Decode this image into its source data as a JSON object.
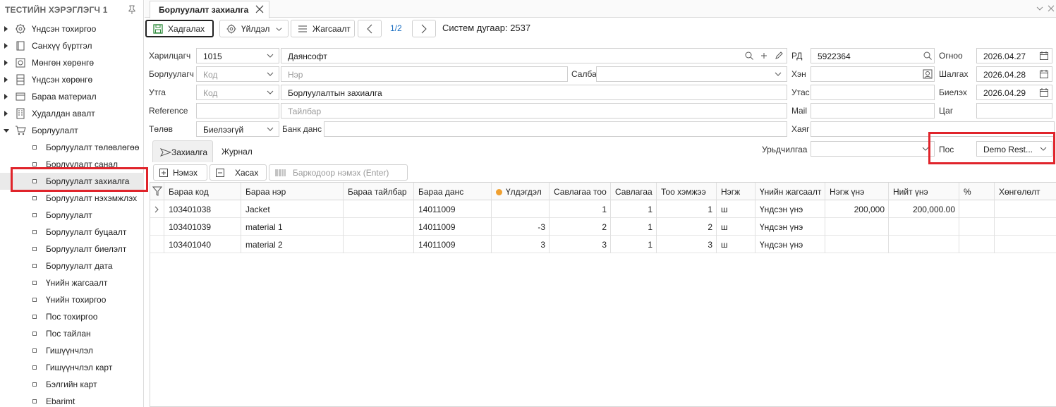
{
  "sidebar": {
    "title": "ТЕСТИЙН ХЭРЭГЛЭГЧ 1",
    "nodes": [
      {
        "label": "Үндсэн тохиргоо",
        "icon": "gear-icon"
      },
      {
        "label": "Санхүү бүртгэл",
        "icon": "book-icon"
      },
      {
        "label": "Мөнгөн хөрөнгө",
        "icon": "safe-icon"
      },
      {
        "label": "Үндсэн хөрөнгө",
        "icon": "cabinet-icon"
      },
      {
        "label": "Бараа материал",
        "icon": "box-icon"
      },
      {
        "label": "Худалдан авалт",
        "icon": "building-icon"
      },
      {
        "label": "Борлуулалт",
        "icon": "cart-icon"
      }
    ],
    "leaves": [
      "Борлуулалт төлөвлөгөө",
      "Борлуулалт санал",
      "Борлуулалт захиалга",
      "Борлуулалт нэхэмжлэх",
      "Борлуулалт",
      "Борлуулалт буцаалт",
      "Борлуулалт биелэлт",
      "Борлуулалт дата",
      "Үнийн жагсаалт",
      "Үнийн тохиргоо",
      "Пос тохиргоо",
      "Пос тайлан",
      "Гишүүнчлэл",
      "Гишүүнчлэл карт",
      "Бэлгийн карт",
      "Ebarimt"
    ]
  },
  "tab": {
    "label": "Борлуулалт захиалга"
  },
  "toolbar": {
    "save": "Хадгалах",
    "actions": "Үйлдэл",
    "list": "Жагсаалт",
    "pager": "1/2",
    "system_number": "Систем дугаар: 2537"
  },
  "form": {
    "customer_label": "Харилцагч",
    "customer_code": "1015",
    "customer_name": "Даянсофт",
    "seller_label": "Борлуулагч",
    "seller_code_ph": "Код",
    "seller_name_ph": "Нэр",
    "branch_label": "Салбар",
    "branch_value": "",
    "flow_label": "Утга",
    "flow_code_ph": "Код",
    "flow_value": "Борлуулалтын захиалга",
    "reference_label": "Reference",
    "reference_value": "",
    "desc_ph": "Тайлбар",
    "payment_label": "Төлөв",
    "payment_value": "Биелээгүй",
    "bank_label": "Банк данс",
    "bank_value": "",
    "rd_label": "РД",
    "rd_value": "5922364",
    "who_label": "Хэн",
    "who_value": "",
    "phone_label": "Утас",
    "phone_value": "",
    "mail_label": "Mail",
    "mail_value": "",
    "address_label": "Хаяг",
    "address_value": "",
    "prepay_label": "Урьдчилгаа",
    "prepay_value": "",
    "date_label": "Огноо",
    "date_value": "2026.04.27",
    "check_label": "Шалгах",
    "check_value": "2026.04.28",
    "fulfill_label": "Биелэх",
    "fulfill_value": "2026.04.29",
    "time_label": "Цаг",
    "time_value": "",
    "pos_label": "Пос",
    "pos_value": "Demo Rest..."
  },
  "subtabs": [
    "Захиалга",
    "Журнал"
  ],
  "grid_toolbar": {
    "add": "Нэмэх",
    "remove": "Хасах",
    "barcode_ph": "Баркодоор нэмэх (Enter)"
  },
  "grid": {
    "columns": [
      "Бараа код",
      "Бараа нэр",
      "Бараа тайлбар",
      "Бараа данс",
      "Үлдэгдэл",
      "Савлагаа тоо",
      "Савлагаа",
      "Тоо хэмжээ",
      "Нэгж",
      "Үнийн жагсаалт",
      "Нэгж үнэ",
      "Нийт үнэ",
      "%",
      "Хөнгөлөлт"
    ],
    "rows": [
      [
        "103401038",
        "Jacket",
        "",
        "14011009",
        "",
        "1",
        "1",
        "1",
        "ш",
        "Үндсэн үнэ",
        "200,000",
        "200,000.00",
        "",
        ""
      ],
      [
        "103401039",
        "material 1",
        "",
        "14011009",
        "-3",
        "2",
        "1",
        "2",
        "ш",
        "Үндсэн үнэ",
        "",
        "",
        "",
        ""
      ],
      [
        "103401040",
        "material 2",
        "",
        "14011009",
        "3",
        "3",
        "1",
        "3",
        "ш",
        "Үндсэн үнэ",
        "",
        "",
        "",
        ""
      ]
    ]
  },
  "colors": {
    "highlight": "#e0242b",
    "link": "#1a6fc2",
    "status_dot": "#f0a030"
  }
}
